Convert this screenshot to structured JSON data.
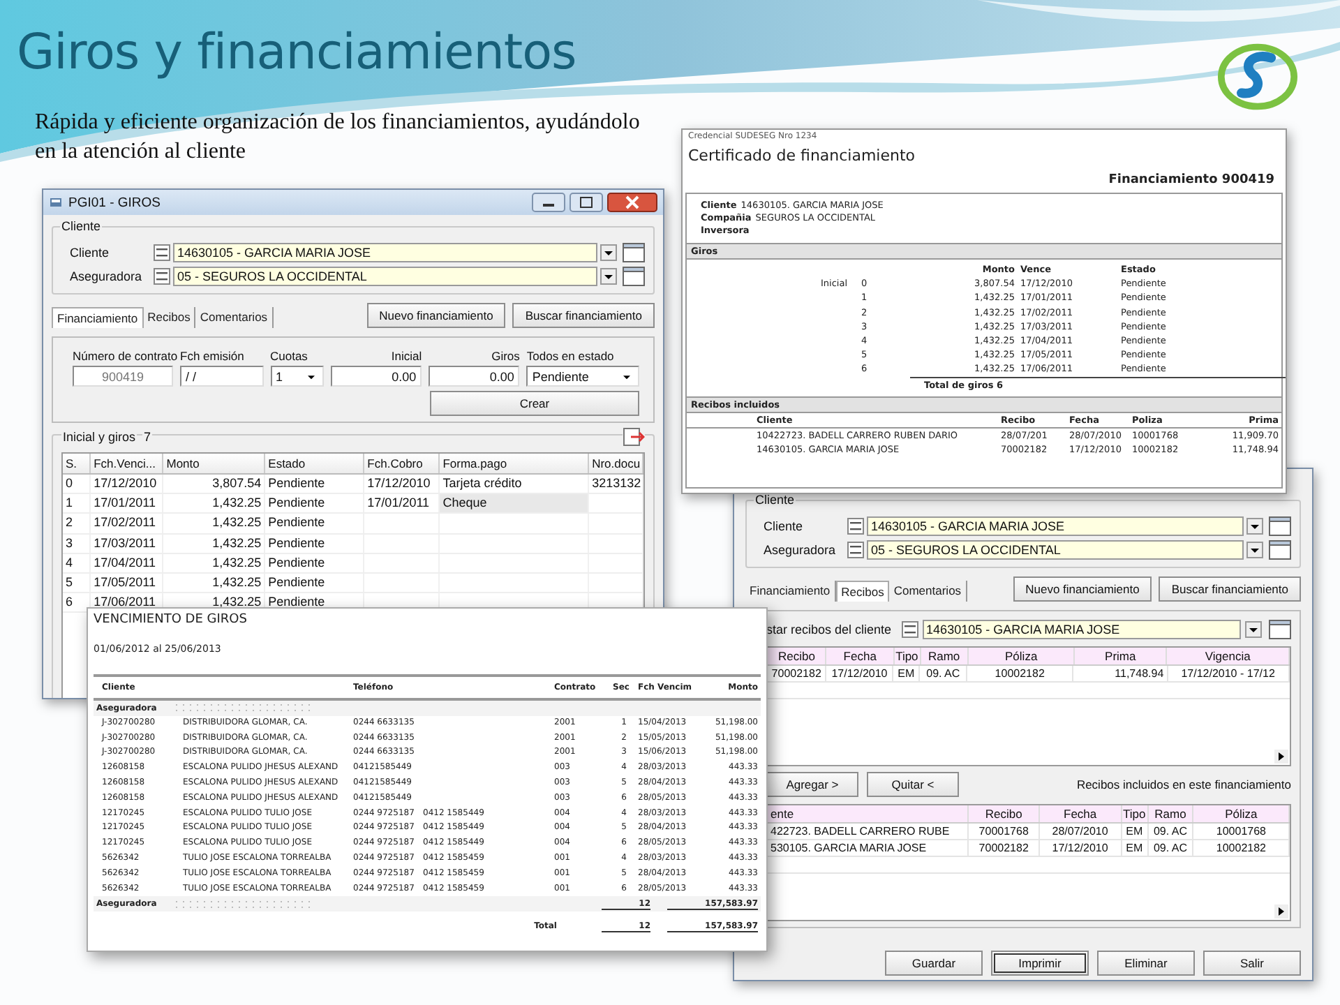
{
  "slide": {
    "title": "Giros y financiamientos",
    "subtitle": "Rápida y eficiente organización de los financiamientos, ayudándolo en la atención al cliente"
  },
  "giros_window": {
    "title": "PGI01 - GIROS",
    "cliente_group": {
      "legend": "Cliente",
      "fields": [
        {
          "label": "Cliente",
          "value": "14630105 - GARCIA MARIA JOSE"
        },
        {
          "label": "Aseguradora",
          "value": "05 - SEGUROS LA OCCIDENTAL"
        }
      ]
    },
    "tabs": [
      {
        "label": "Financiamiento",
        "selected": true
      },
      {
        "label": "Recibos",
        "selected": false
      },
      {
        "label": "Comentarios",
        "selected": false
      }
    ],
    "buttons": [
      "Nuevo financiamiento",
      "Buscar financiamiento"
    ],
    "form": {
      "fields": [
        {
          "label": "Número de contrato",
          "value": "900419",
          "kind": "readonly"
        },
        {
          "label": "Fch emisión",
          "value": "/ /",
          "kind": "text"
        },
        {
          "label": "Cuotas",
          "value": "1",
          "kind": "select"
        },
        {
          "label": "Inicial",
          "value": "0.00",
          "kind": "number"
        },
        {
          "label": "Giros",
          "value": "0.00",
          "kind": "number"
        },
        {
          "label": "Todos en estado",
          "value": "Pendiente",
          "kind": "select"
        }
      ],
      "create_button": "Crear"
    },
    "grid": {
      "legend": "Inicial y giros",
      "count": "7",
      "columns": [
        "S.",
        "Fch.Venci...",
        "Monto",
        "Estado",
        "Fch.Cobro",
        "Forma.pago",
        "Nro.docu"
      ],
      "rows": [
        {
          "s": "0",
          "vence": "17/12/2010",
          "monto": "3,807.54",
          "estado": "Pendiente",
          "cobro": "17/12/2010",
          "forma": "Tarjeta crédito",
          "doc": "3213132"
        },
        {
          "s": "1",
          "vence": "17/01/2011",
          "monto": "1,432.25",
          "estado": "Pendiente",
          "cobro": "17/01/2011",
          "forma": "Cheque"
        },
        {
          "s": "2",
          "vence": "17/02/2011",
          "monto": "1,432.25",
          "estado": "Pendiente"
        },
        {
          "s": "3",
          "vence": "17/03/2011",
          "monto": "1,432.25",
          "estado": "Pendiente"
        },
        {
          "s": "4",
          "vence": "17/04/2011",
          "monto": "1,432.25",
          "estado": "Pendiente"
        },
        {
          "s": "5",
          "vence": "17/05/2011",
          "monto": "1,432.25",
          "estado": "Pendiente"
        },
        {
          "s": "6",
          "vence": "17/06/2011",
          "monto": "1,432.25",
          "estado": "Pendiente"
        }
      ]
    }
  },
  "certificate": {
    "header": "Credencial SUDESEG Nro 1234",
    "title": "Certificado de financiamiento",
    "number": "Financiamiento 900419",
    "info": [
      {
        "label": "Cliente",
        "value": "14630105. GARCIA MARIA JOSE"
      },
      {
        "label": "Compañia",
        "value": "SEGUROS LA OCCIDENTAL"
      },
      {
        "label": "Inversora"
      }
    ],
    "giros": {
      "heading": "Giros",
      "columns": [
        "Monto",
        "Vence",
        "Estado"
      ],
      "rows": [
        {
          "label": "Inicial",
          "n": "0",
          "monto": "3,807.54",
          "vence": "17/12/2010",
          "estado": "Pendiente"
        },
        {
          "n": "1",
          "monto": "1,432.25",
          "vence": "17/01/2011",
          "estado": "Pendiente"
        },
        {
          "n": "2",
          "monto": "1,432.25",
          "vence": "17/02/2011",
          "estado": "Pendiente"
        },
        {
          "n": "3",
          "monto": "1,432.25",
          "vence": "17/03/2011",
          "estado": "Pendiente"
        },
        {
          "n": "4",
          "monto": "1,432.25",
          "vence": "17/04/2011",
          "estado": "Pendiente"
        },
        {
          "n": "5",
          "monto": "1,432.25",
          "vence": "17/05/2011",
          "estado": "Pendiente"
        },
        {
          "n": "6",
          "monto": "1,432.25",
          "vence": "17/06/2011",
          "estado": "Pendiente"
        }
      ],
      "total": "Total de giros 6"
    },
    "recibos": {
      "heading": "Recibos incluidos",
      "columns": [
        "Cliente",
        "Recibo",
        "Fecha",
        "Poliza",
        "Prima"
      ],
      "rows": [
        [
          "10422723. BADELL CARRERO RUBEN DARIO",
          "28/07/201",
          "28/07/2010",
          "10001768",
          "11,909.70"
        ],
        [
          "14630105. GARCIA MARIA JOSE",
          "70002182",
          "17/12/2010",
          "10002182",
          "11,748.94"
        ]
      ]
    }
  },
  "report": {
    "title": "VENCIMIENTO DE GIROS",
    "range": "01/06/2012 al 25/06/2013",
    "columns": [
      "Cliente",
      "Teléfono",
      "Contrato",
      "Sec",
      "Fch Vencim",
      "Monto"
    ],
    "group_label": "Aseguradora",
    "rows": [
      {
        "id": "J-302700280",
        "name": "DISTRIBUIDORA GLOMAR, CA.",
        "phone1": "0244 6633135",
        "contrato": "2001",
        "sec": "1",
        "fecha": "15/04/2013",
        "monto": "51,198.00"
      },
      {
        "id": "J-302700280",
        "name": "DISTRIBUIDORA GLOMAR, CA.",
        "phone1": "0244 6633135",
        "contrato": "2001",
        "sec": "2",
        "fecha": "15/05/2013",
        "monto": "51,198.00"
      },
      {
        "id": "J-302700280",
        "name": "DISTRIBUIDORA GLOMAR, CA.",
        "phone1": "0244 6633135",
        "contrato": "2001",
        "sec": "3",
        "fecha": "15/06/2013",
        "monto": "51,198.00"
      },
      {
        "id": "12608158",
        "name": "ESCALONA PULIDO JHESUS ALEXAND",
        "phone1": "04121585449",
        "contrato": "003",
        "sec": "4",
        "fecha": "28/03/2013",
        "monto": "443.33"
      },
      {
        "id": "12608158",
        "name": "ESCALONA PULIDO JHESUS ALEXAND",
        "phone1": "04121585449",
        "contrato": "003",
        "sec": "5",
        "fecha": "28/04/2013",
        "monto": "443.33"
      },
      {
        "id": "12608158",
        "name": "ESCALONA PULIDO JHESUS ALEXAND",
        "phone1": "04121585449",
        "contrato": "003",
        "sec": "6",
        "fecha": "28/05/2013",
        "monto": "443.33"
      },
      {
        "id": "12170245",
        "name": "ESCALONA PULIDO TULIO JOSE",
        "phone1": "0244 9725187",
        "phone2": "0412 1585449",
        "contrato": "004",
        "sec": "4",
        "fecha": "28/03/2013",
        "monto": "443.33"
      },
      {
        "id": "12170245",
        "name": "ESCALONA PULIDO TULIO JOSE",
        "phone1": "0244 9725187",
        "phone2": "0412 1585449",
        "contrato": "004",
        "sec": "5",
        "fecha": "28/04/2013",
        "monto": "443.33"
      },
      {
        "id": "12170245",
        "name": "ESCALONA PULIDO TULIO JOSE",
        "phone1": "0244 9725187",
        "phone2": "0412 1585449",
        "contrato": "004",
        "sec": "6",
        "fecha": "28/05/2013",
        "monto": "443.33"
      },
      {
        "id": "5626342",
        "name": "TULIO JOSE ESCALONA TORREALBA",
        "phone1": "0244 9725187",
        "phone2": "0412 1585459",
        "contrato": "001",
        "sec": "4",
        "fecha": "28/03/2013",
        "monto": "443.33"
      },
      {
        "id": "5626342",
        "name": "TULIO JOSE ESCALONA TORREALBA",
        "phone1": "0244 9725187",
        "phone2": "0412 1585459",
        "contrato": "001",
        "sec": "5",
        "fecha": "28/04/2013",
        "monto": "443.33"
      },
      {
        "id": "5626342",
        "name": "TULIO JOSE ESCALONA TORREALBA",
        "phone1": "0244 9725187",
        "phone2": "0412 1585459",
        "contrato": "001",
        "sec": "6",
        "fecha": "28/05/2013",
        "monto": "443.33"
      }
    ],
    "subtotal": {
      "label": "Aseguradora",
      "count": "12",
      "amount": "157,583.97"
    },
    "total": {
      "label": "Total",
      "count": "12",
      "amount": "157,583.97"
    }
  },
  "recibos_window": {
    "cliente_group": {
      "legend": "Cliente",
      "fields": [
        {
          "label": "Cliente",
          "value": "14630105 - GARCIA MARIA JOSE"
        },
        {
          "label": "Aseguradora",
          "value": "05 - SEGUROS LA OCCIDENTAL"
        }
      ]
    },
    "tabs": [
      {
        "label": "Financiamiento",
        "selected": false
      },
      {
        "label": "Recibos",
        "selected": true
      },
      {
        "label": "Comentarios",
        "selected": false
      }
    ],
    "buttons": [
      "Nuevo financiamiento",
      "Buscar financiamiento"
    ],
    "listar": {
      "label": "star recibos del cliente",
      "value": "14630105 - GARCIA MARIA JOSE"
    },
    "top_grid": {
      "columns": [
        "Recibo",
        "Fecha",
        "Tipo",
        "Ramo",
        "Póliza",
        "Prima",
        "Vigencia"
      ],
      "rows": [
        [
          "70002182",
          "17/12/2010",
          "EM",
          "09. AC",
          "10002182",
          "11,748.94",
          "17/12/2010 - 17/12"
        ]
      ]
    },
    "move_buttons": [
      "Agregar >",
      "Quitar <"
    ],
    "caption": "Recibos incluidos en este financiamiento",
    "bottom_grid": {
      "columns": [
        "ente",
        "Recibo",
        "Fecha",
        "Tipo",
        "Ramo",
        "Póliza"
      ],
      "rows": [
        [
          "422723. BADELL CARRERO RUBE",
          "70001768",
          "28/07/2010",
          "EM",
          "09. AC",
          "10001768"
        ],
        [
          "530105. GARCIA MARIA JOSE",
          "70002182",
          "17/12/2010",
          "EM",
          "09. AC",
          "10002182"
        ]
      ]
    },
    "footer_buttons": [
      {
        "label": "Guardar",
        "focused": false
      },
      {
        "label": "Imprimir",
        "focused": true
      },
      {
        "label": "Eliminar",
        "focused": false
      },
      {
        "label": "Salir",
        "focused": false
      }
    ]
  }
}
